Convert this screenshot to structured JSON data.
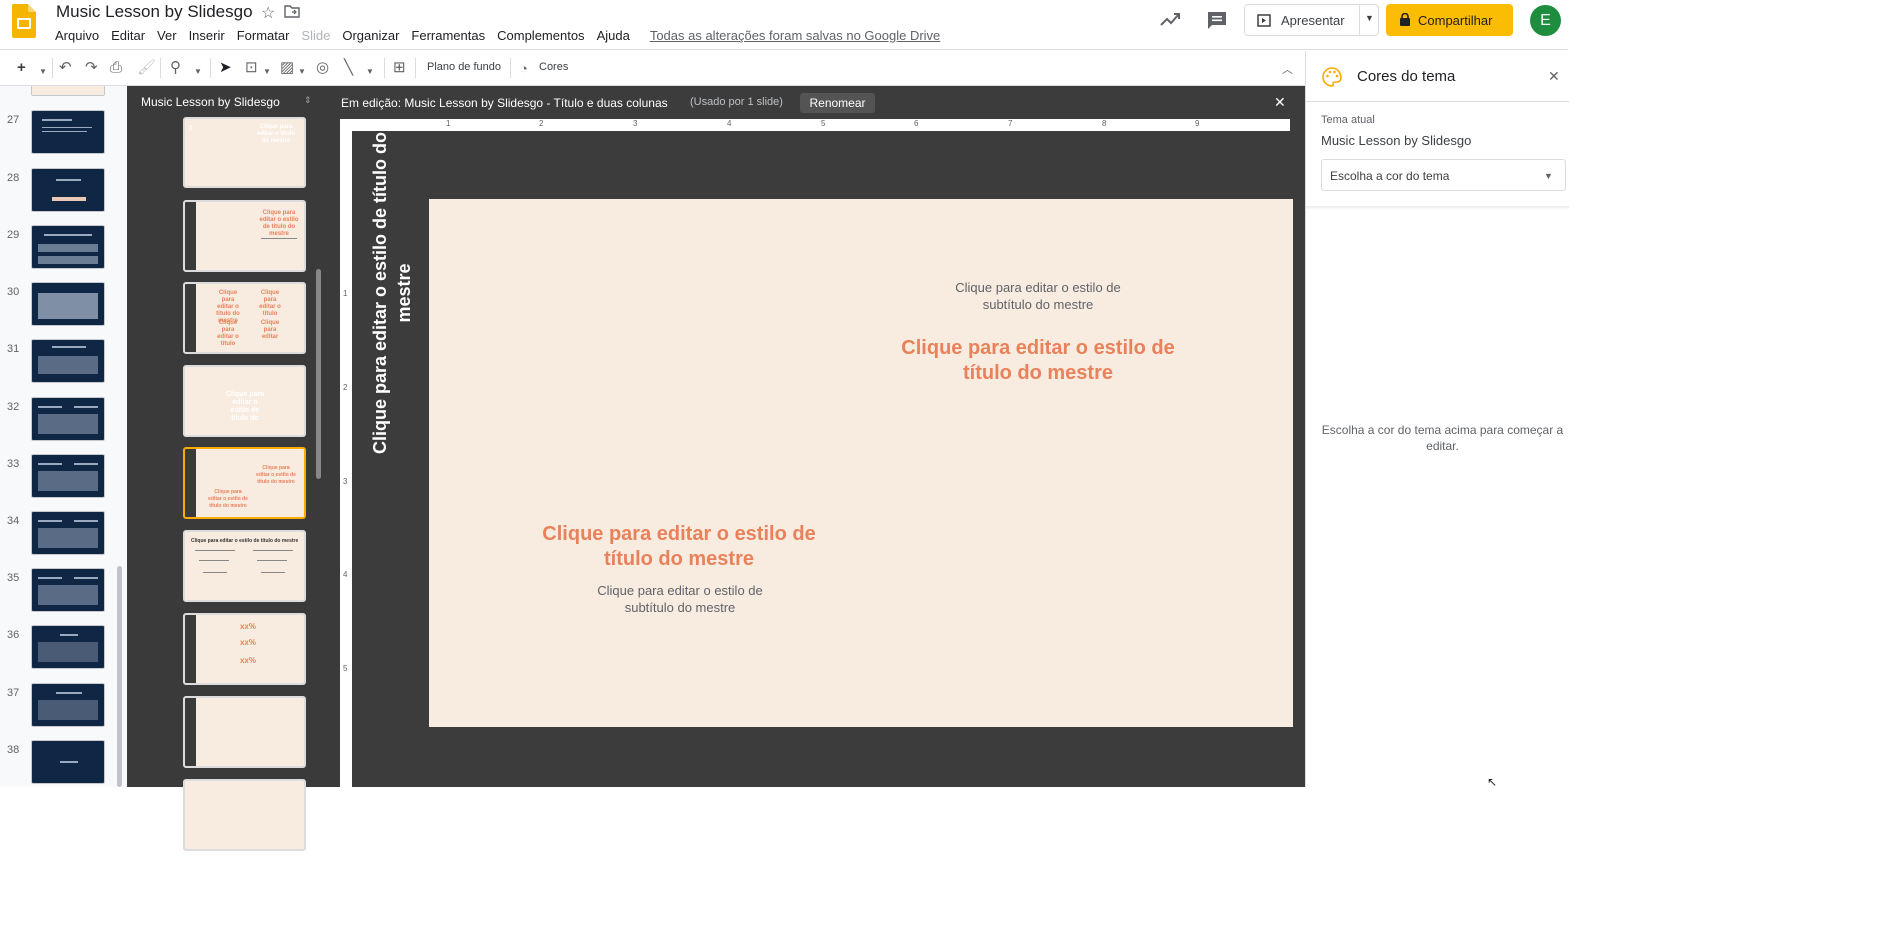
{
  "doc": {
    "title": "Music Lesson by Slidesgo"
  },
  "menu": [
    "Arquivo",
    "Editar",
    "Ver",
    "Inserir",
    "Formatar",
    "Slide",
    "Organizar",
    "Ferramentas",
    "Complementos",
    "Ajuda"
  ],
  "save_status": "Todas as alterações foram salvas no Google Drive",
  "actions": {
    "present": "Apresentar",
    "share": "Compartilhar",
    "avatar": "E"
  },
  "toolbar": {
    "background": "Plano de fundo",
    "colors": "Cores"
  },
  "filmstrip": {
    "slides": [
      "27",
      "28",
      "29",
      "30",
      "31",
      "32",
      "33",
      "34",
      "35",
      "36",
      "37",
      "38"
    ]
  },
  "layouts_panel": {
    "title": "Music Lesson by Slidesgo",
    "thumb_number": "1",
    "thumb_xx": "xx%"
  },
  "edit_bar": {
    "title": "Em edição: Music Lesson by Slidesgo - Título e duas colunas",
    "used": "(Usado por 1 slide)",
    "rename": "Renomear"
  },
  "ruler": {
    "h": [
      "1",
      "2",
      "3",
      "4",
      "5",
      "6",
      "7",
      "8",
      "9"
    ],
    "v": [
      "1",
      "2",
      "3",
      "4",
      "5"
    ]
  },
  "slide": {
    "vertical_title": "Clique para editar o estilo de título do mestre",
    "subtitle_right": "Clique para editar o estilo de subtítulo do mestre",
    "title_right": "Clique para editar o estilo de título do mestre",
    "title_left": "Clique para editar o estilo de título do mestre",
    "subtitle_left": "Clique para editar o estilo de subtítulo do mestre"
  },
  "theme_panel": {
    "title": "Cores do tema",
    "current_label": "Tema atual",
    "current_name": "Music Lesson by Slidesgo",
    "select_placeholder": "Escolha a cor do tema",
    "hint": "Escolha a cor do tema acima para começar a editar."
  },
  "colors": {
    "accent": "#e9825a",
    "share": "#fbbc04",
    "slide_bg": "#f8ebe0",
    "dark": "#3c3c3c"
  }
}
